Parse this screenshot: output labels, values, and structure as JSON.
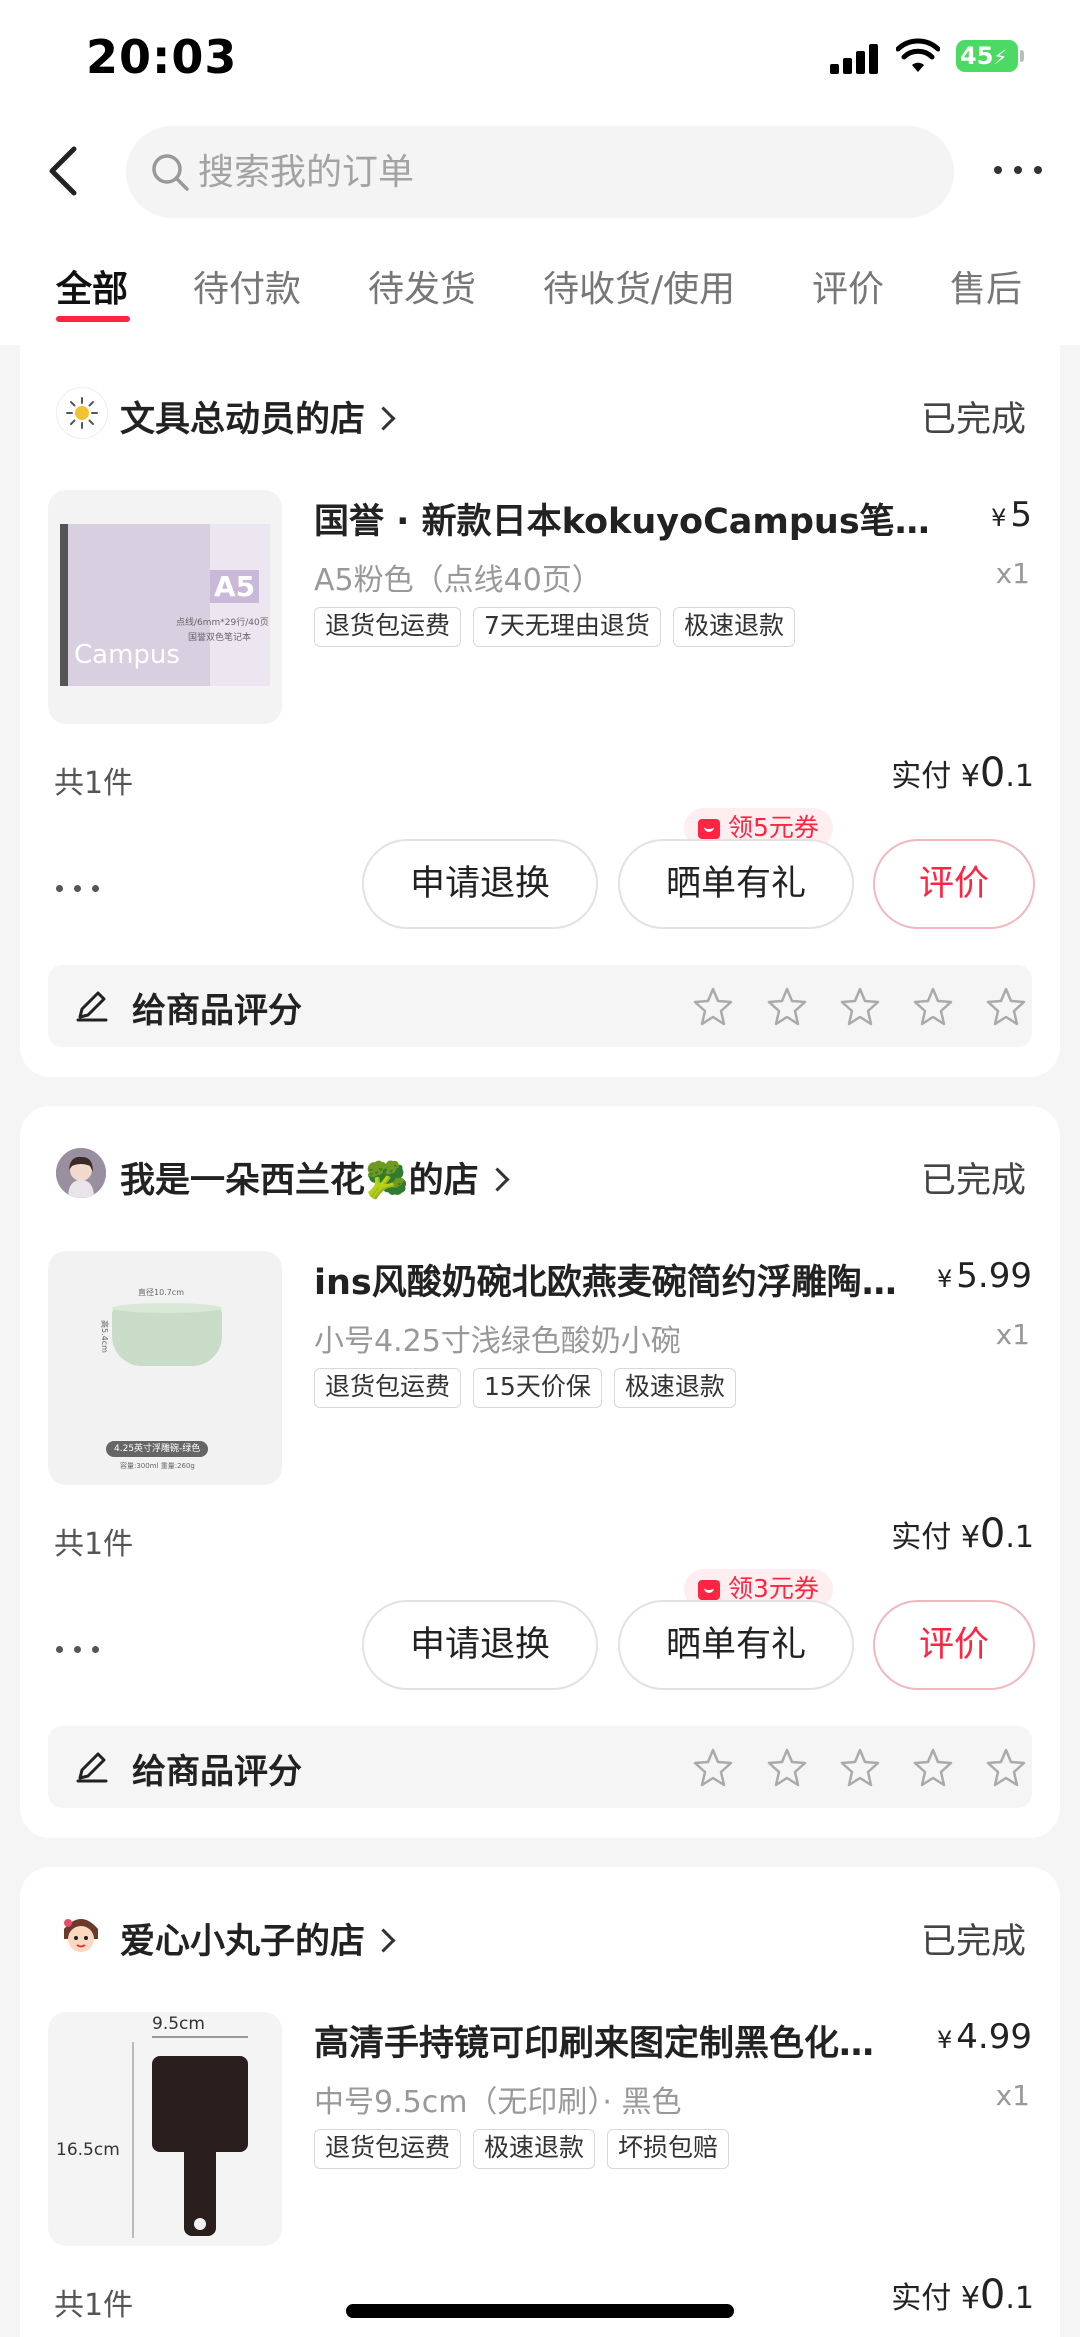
{
  "status_bar": {
    "time": "20:03",
    "battery": "45"
  },
  "search": {
    "placeholder": "搜索我的订单"
  },
  "tabs": [
    "全部",
    "待付款",
    "待发货",
    "待收货/使用",
    "评价",
    "售后"
  ],
  "orders": [
    {
      "shop": "文具总动员的店",
      "status": "已完成",
      "title": "国誉 · 新款日本kokuyoCampus笔记本",
      "price": "5",
      "spec": "A5粉色（点线40页）",
      "qty": "x1",
      "tags": [
        "退货包运费",
        "7天无理由退货",
        "极速退款"
      ],
      "count": "共1件",
      "paid_label": "实付",
      "paid_int": "0",
      "paid_dec": ".1",
      "coupon": "领5元券",
      "buttons": [
        "申请退换",
        "晒单有礼",
        "评价"
      ],
      "rate_label": "给商品评分",
      "thumb_text": [
        "A5",
        "Campus",
        "点线/6mm*29行/40页",
        "国誉双色笔记本"
      ]
    },
    {
      "shop": "我是一朵西兰花🥦的店",
      "status": "已完成",
      "title": "ins风酸奶碗北欧燕麦碗简约浮雕陶瓷碗",
      "price": "5.99",
      "spec": "小号4.25寸浅绿色酸奶小碗",
      "qty": "x1",
      "tags": [
        "退货包运费",
        "15天价保",
        "极速退款"
      ],
      "count": "共1件",
      "paid_label": "实付",
      "paid_int": "0",
      "paid_dec": ".1",
      "coupon": "领3元券",
      "buttons": [
        "申请退换",
        "晒单有礼",
        "评价"
      ],
      "rate_label": "给商品评分",
      "thumb_text": [
        "直径10.7cm",
        "高5.4cm",
        "4.25英寸浮雕碗-绿色",
        "容量:300ml  重量:260g"
      ]
    },
    {
      "shop": "爱心小丸子的店",
      "status": "已完成",
      "title": "高清手持镜可印刷来图定制黑色化妆镜",
      "price": "4.99",
      "spec": "中号9.5cm（无印刷）· 黑色",
      "qty": "x1",
      "tags": [
        "退货包运费",
        "极速退款",
        "坏损包赔"
      ],
      "count": "共1件",
      "paid_label": "实付",
      "paid_int": "0",
      "paid_dec": ".1",
      "thumb_text": [
        "9.5cm",
        "16.5cm"
      ]
    }
  ],
  "colors": {
    "accent": "#ff2442",
    "page_bg": "#f5f5f5"
  }
}
